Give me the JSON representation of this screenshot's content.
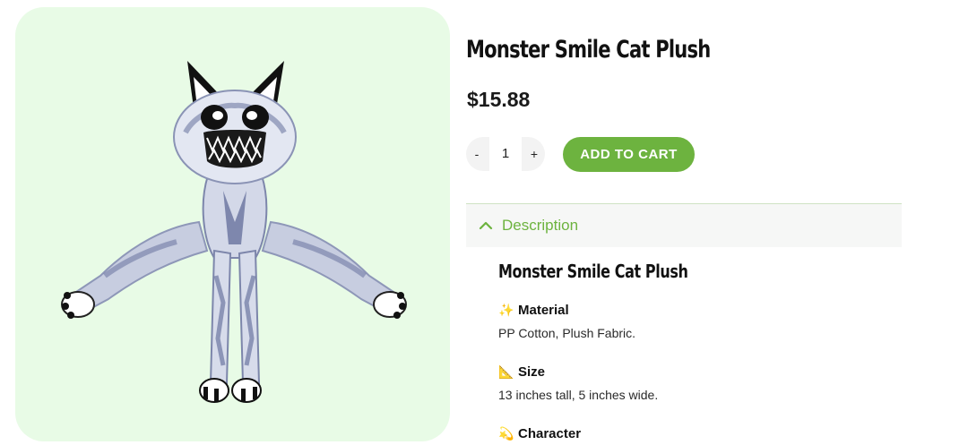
{
  "product": {
    "title": "Monster Smile Cat Plush",
    "price": "$15.88"
  },
  "quantity": {
    "minus": "-",
    "value": "1",
    "plus": "+"
  },
  "cart": {
    "add_label": "ADD TO CART"
  },
  "description": {
    "header": "Description",
    "title": "Monster Smile Cat Plush",
    "specs": [
      {
        "emoji": "✨",
        "heading": "Material",
        "value": "PP Cotton, Plush Fabric."
      },
      {
        "emoji": "📐",
        "heading": "Size",
        "value": "13 inches tall, 5 inches wide."
      },
      {
        "emoji": "💫",
        "heading": "Character",
        "value": ""
      }
    ]
  },
  "colors": {
    "accent": "#6db33f",
    "image_bg": "#e8fbe6"
  }
}
